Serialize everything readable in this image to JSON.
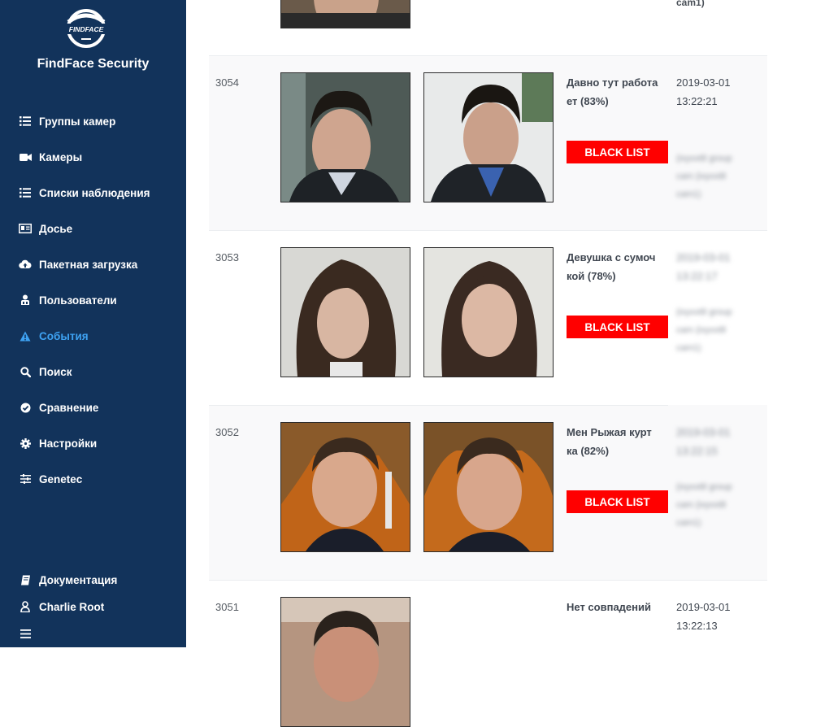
{
  "app": {
    "title": "FindFace Security",
    "logo_text": "FINDFACE"
  },
  "nav": {
    "items": [
      {
        "label": "Группы камер",
        "icon": "list-icon"
      },
      {
        "label": "Камеры",
        "icon": "video-camera-icon"
      },
      {
        "label": "Списки наблюдения",
        "icon": "list-icon"
      },
      {
        "label": "Досье",
        "icon": "id-card-icon"
      },
      {
        "label": "Пакетная загрузка",
        "icon": "cloud-upload-icon"
      },
      {
        "label": "Пользователи",
        "icon": "users-icon"
      },
      {
        "label": "События",
        "icon": "warning-icon",
        "active": true
      },
      {
        "label": "Поиск",
        "icon": "search-icon"
      },
      {
        "label": "Сравнение",
        "icon": "check-circle-icon"
      },
      {
        "label": "Настройки",
        "icon": "gear-icon"
      },
      {
        "label": "Genetec",
        "icon": "sliders-icon"
      }
    ],
    "footer": {
      "docs_label": "Документация",
      "user_label": "Charlie Root",
      "menu_icon": "hamburger-icon"
    }
  },
  "events": {
    "partial_top": {
      "camera": "cam1)"
    },
    "rows": [
      {
        "id": "3054",
        "match": "Давно тут работа ет (83%)",
        "badge": "BLACK LIST",
        "badge_color": "#ff0000",
        "date": "2019-03-01",
        "time": "13:22:21",
        "camera_line1": "(ixyxxt8 group",
        "camera_line2": "cam (ixyxxt8",
        "camera_line3": "cam1)"
      },
      {
        "id": "3053",
        "match": "Девушка с сумоч кой (78%)",
        "badge": "BLACK LIST",
        "badge_color": "#ff0000",
        "date": "2019-03-01",
        "time": "13:22:17",
        "camera_line1": "(ixyxxt8 group",
        "camera_line2": "cam (ixyxxt8",
        "camera_line3": "cam1)"
      },
      {
        "id": "3052",
        "match": "Мен Рыжая курт ка (82%)",
        "badge": "BLACK LIST",
        "badge_color": "#ff0000",
        "date": "2019-03-01",
        "time": "13:22:15",
        "camera_line1": "(ixyxxt8 group",
        "camera_line2": "cam (ixyxxt8",
        "camera_line3": "cam1)"
      },
      {
        "id": "3051",
        "match": "Нет совпадений",
        "date": "2019-03-01",
        "time": "13:22:13"
      }
    ]
  },
  "colors": {
    "sidebar": "#12335b",
    "active": "#3ea2f2",
    "badge": "#ff0000"
  }
}
